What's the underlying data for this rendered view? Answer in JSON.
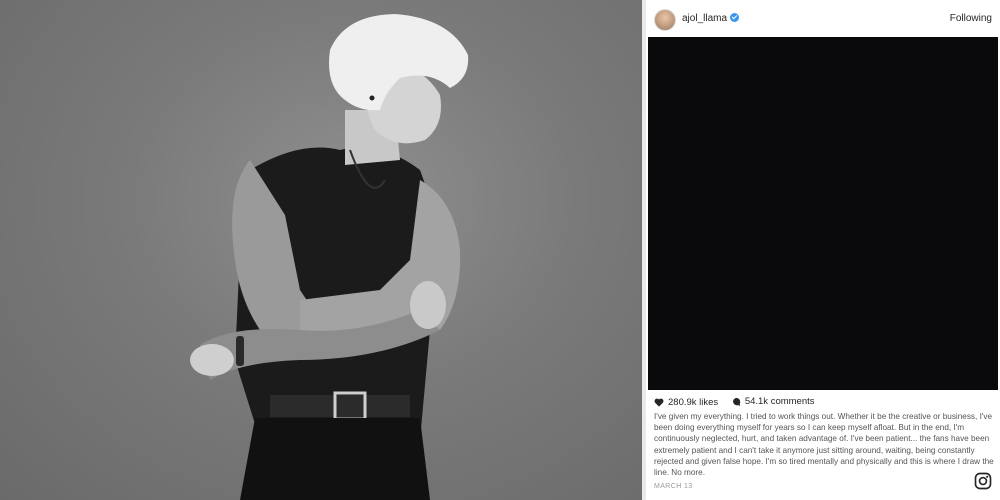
{
  "post": {
    "username": "ajol_llama",
    "follow_status": "Following",
    "likes": "280.9k likes",
    "comments": "54.1k comments",
    "caption": "I've given my everything. I tried to work things out. Whether it be the creative or business, I've been doing everything myself for years so I can keep myself afloat. But in the end, I'm continuously neglected, hurt, and taken advantage of. I've been patient... the fans have been extremely patient and I can't take it anymore just sitting around, waiting, being constantly rejected and given false hope. I'm so tired mentally and physically and this is where I draw the line. No more.",
    "date": "MARCH 13"
  },
  "icons": {
    "verified": "verified-badge-icon",
    "like": "heart-icon",
    "comment": "comment-bubble-icon",
    "brand": "instagram-icon"
  },
  "colors": {
    "verified_blue": "#3897f0",
    "post_image_bg": "#0a0a0c",
    "photo_bg": "#7a7a7a"
  }
}
